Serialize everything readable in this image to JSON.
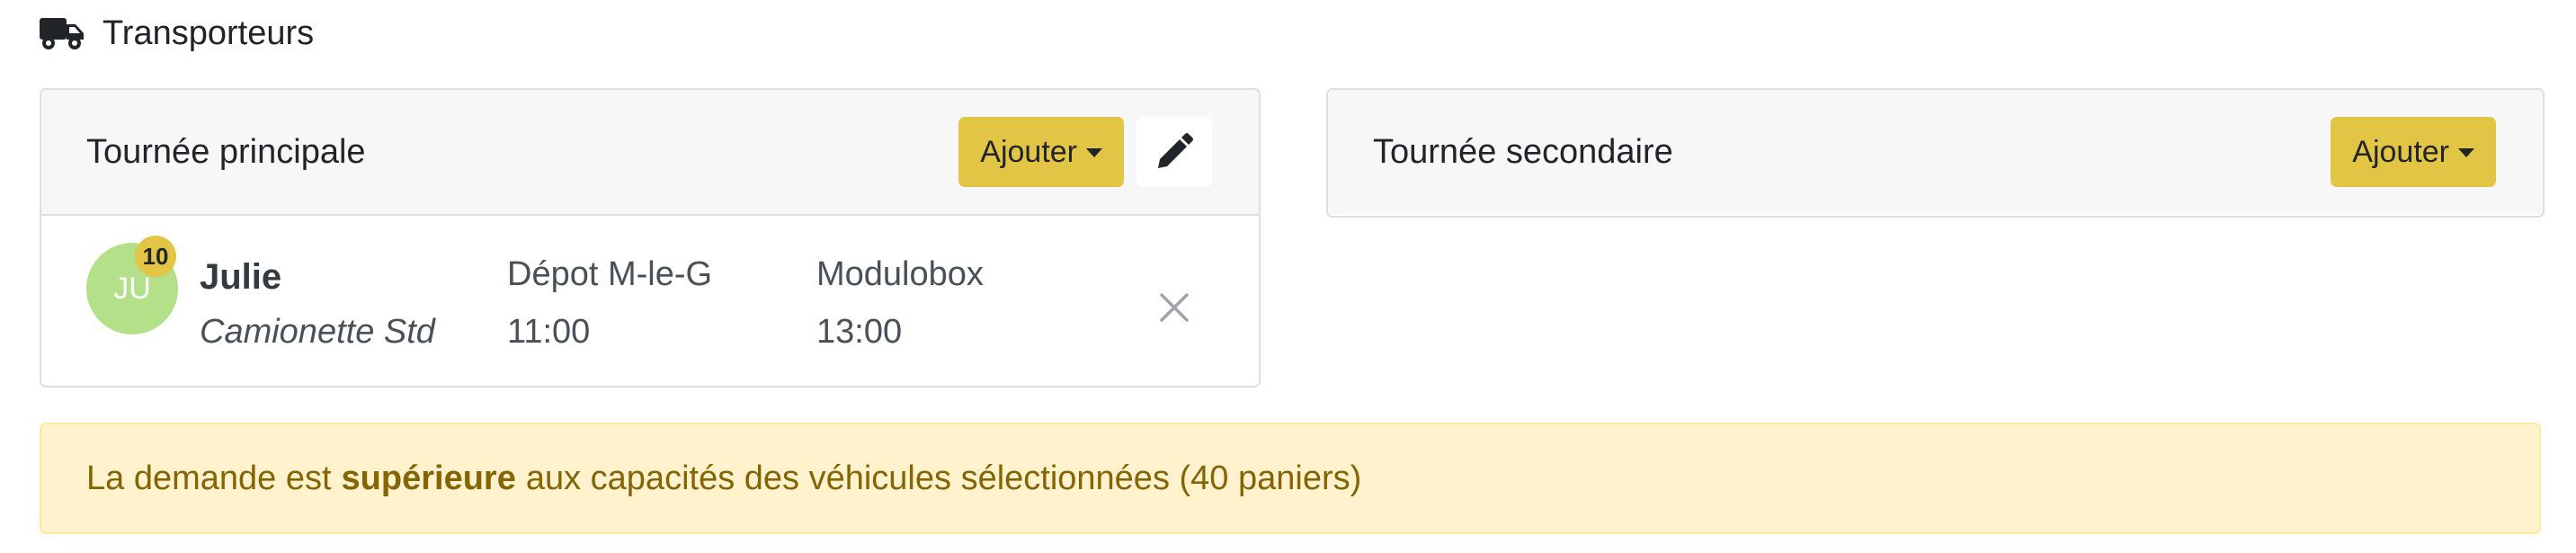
{
  "section": {
    "title": "Transporteurs",
    "icon": "truck-icon"
  },
  "main_round": {
    "title": "Tournée principale",
    "add_label": "Ajouter",
    "edit_icon": "pencil-icon",
    "transporters": [
      {
        "initials": "JU",
        "badge": "10",
        "name": "Julie",
        "vehicle": "Camionette Std",
        "stops": [
          {
            "label": "Dépot M-le-G",
            "time": "11:00"
          },
          {
            "label": "Modulobox",
            "time": "13:00"
          }
        ]
      }
    ]
  },
  "secondary_round": {
    "title": "Tournée secondaire",
    "add_label": "Ajouter"
  },
  "alert": {
    "before": "La demande est",
    "emphasis": "supérieure",
    "after": "aux capacités des véhicules sélectionnées (40 paniers)"
  },
  "colors": {
    "accent": "#e3c545",
    "avatar": "#b3e089",
    "alert_bg": "#fff2cd",
    "alert_text": "#856404"
  }
}
